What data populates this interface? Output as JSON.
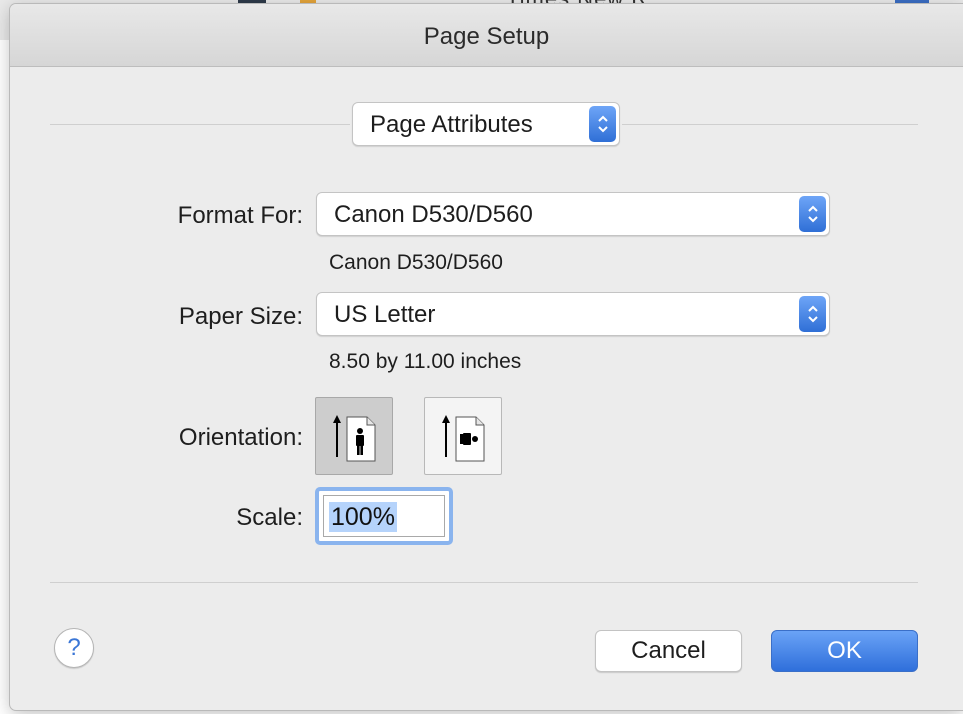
{
  "background_app": {
    "toolbar_text": "Times New R"
  },
  "dialog": {
    "title": "Page Setup",
    "section_popup": {
      "value": "Page Attributes"
    },
    "format_for": {
      "label": "Format For:",
      "value": "Canon D530/D560",
      "detail": "Canon D530/D560"
    },
    "paper_size": {
      "label": "Paper Size:",
      "value": "US Letter",
      "detail": "8.50 by 11.00 inches"
    },
    "orientation": {
      "label": "Orientation:",
      "options": [
        "portrait",
        "landscape"
      ],
      "selected": "portrait"
    },
    "scale": {
      "label": "Scale:",
      "value": "100%"
    },
    "buttons": {
      "help": "?",
      "cancel": "Cancel",
      "ok": "OK"
    }
  },
  "colors": {
    "accent": "#2f6fd6",
    "dialog_bg": "#ececec",
    "focus_ring": "#8ab4ee",
    "selection": "#b5d3fb"
  }
}
